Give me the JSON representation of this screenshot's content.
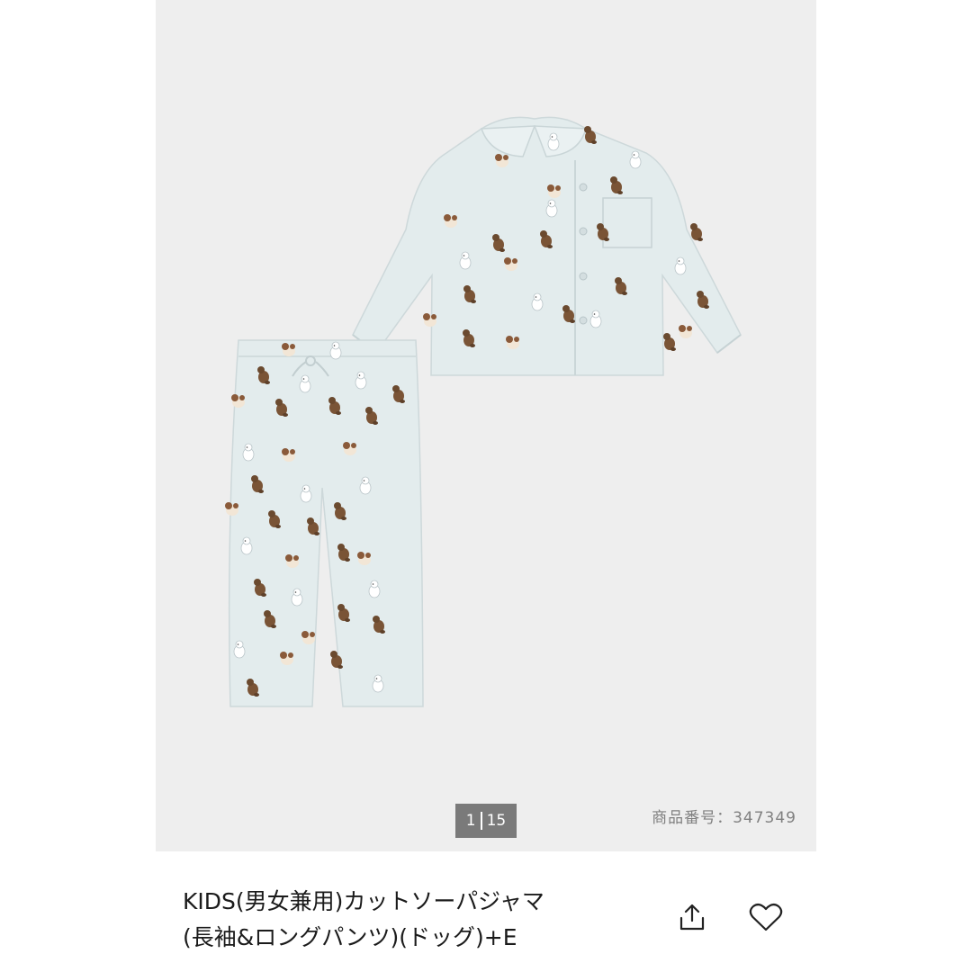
{
  "gallery": {
    "current_index": "1",
    "total_count": "15",
    "product_number": "商品番号：347349",
    "background": "#eeeeee",
    "garment_color": "#e3eced",
    "print_color": "#7a5436"
  },
  "product": {
    "title_line1": "KIDS(男女兼用)カットソーパジャマ",
    "title_line2": "(長袖&ロングパンツ)(ドッグ)+E"
  },
  "actions": {
    "share_icon": "share-icon",
    "favorite_icon": "heart-icon"
  }
}
